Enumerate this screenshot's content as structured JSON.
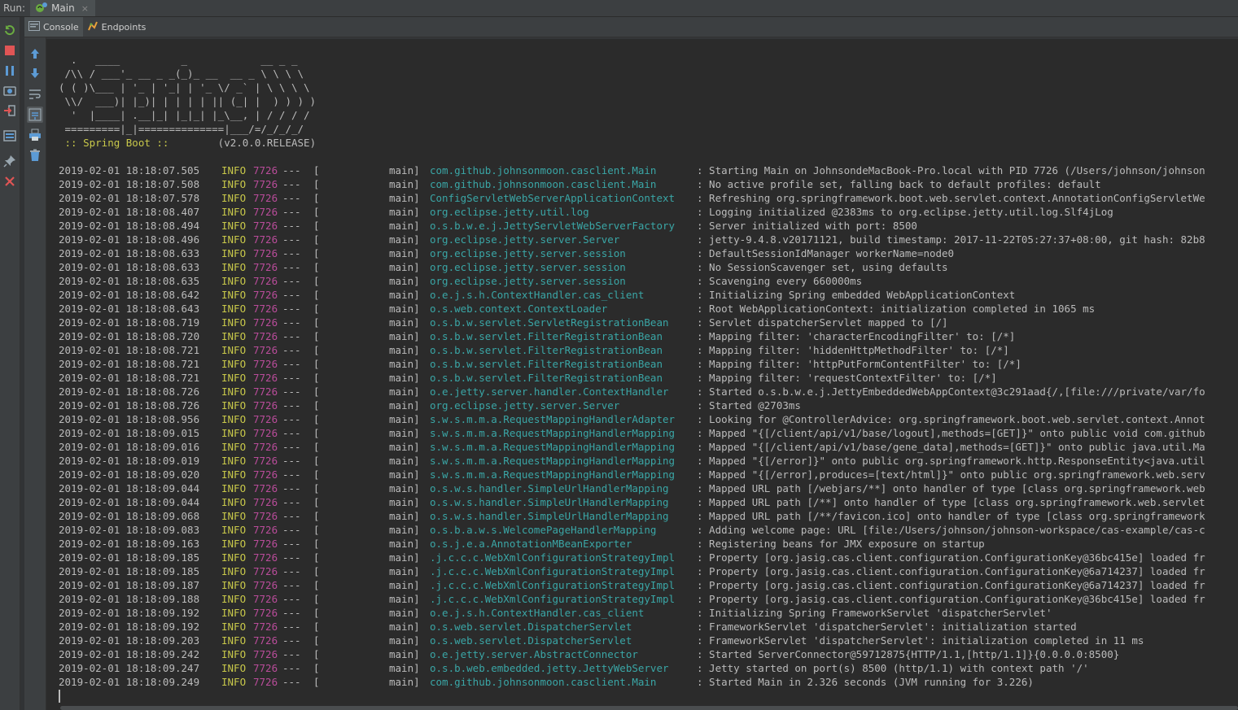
{
  "run_bar": {
    "label": "Run:",
    "tab_title": "Main",
    "close_glyph": "×"
  },
  "sub_tabs": {
    "console": "Console",
    "endpoints": "Endpoints"
  },
  "banner": {
    "lines": [
      "  .   ____          _            __ _ _",
      " /\\\\ / ___'_ __ _ _(_)_ __  __ _ \\ \\ \\ \\",
      "( ( )\\___ | '_ | '_| | '_ \\/ _` | \\ \\ \\ \\",
      " \\\\/  ___)| |_)| | | | | || (_| |  ) ) ) )",
      "  '  |____| .__|_| |_|_| |_\\__, | / / / /",
      " =========|_|==============|___/=/_/_/_/"
    ],
    "spring_label": " :: Spring Boot :: ",
    "version": "       (v2.0.0.RELEASE)"
  },
  "log": [
    {
      "ts": "2019-02-01 18:18:07.505",
      "level": "INFO",
      "pid": "7726",
      "sep": "---",
      "thread": "main]",
      "logger": "com.github.johnsonmoon.casclient.Main",
      "msg": ": Starting Main on JohnsondeMacBook-Pro.local with PID 7726 (/Users/johnson/johnson"
    },
    {
      "ts": "2019-02-01 18:18:07.508",
      "level": "INFO",
      "pid": "7726",
      "sep": "---",
      "thread": "main]",
      "logger": "com.github.johnsonmoon.casclient.Main",
      "msg": ": No active profile set, falling back to default profiles: default"
    },
    {
      "ts": "2019-02-01 18:18:07.578",
      "level": "INFO",
      "pid": "7726",
      "sep": "---",
      "thread": "main]",
      "logger": "ConfigServletWebServerApplicationContext",
      "msg": ": Refreshing org.springframework.boot.web.servlet.context.AnnotationConfigServletWe"
    },
    {
      "ts": "2019-02-01 18:18:08.407",
      "level": "INFO",
      "pid": "7726",
      "sep": "---",
      "thread": "main]",
      "logger": "org.eclipse.jetty.util.log",
      "msg": ": Logging initialized @2383ms to org.eclipse.jetty.util.log.Slf4jLog"
    },
    {
      "ts": "2019-02-01 18:18:08.494",
      "level": "INFO",
      "pid": "7726",
      "sep": "---",
      "thread": "main]",
      "logger": "o.s.b.w.e.j.JettyServletWebServerFactory",
      "msg": ": Server initialized with port: 8500"
    },
    {
      "ts": "2019-02-01 18:18:08.496",
      "level": "INFO",
      "pid": "7726",
      "sep": "---",
      "thread": "main]",
      "logger": "org.eclipse.jetty.server.Server",
      "msg": ": jetty-9.4.8.v20171121, build timestamp: 2017-11-22T05:27:37+08:00, git hash: 82b8"
    },
    {
      "ts": "2019-02-01 18:18:08.633",
      "level": "INFO",
      "pid": "7726",
      "sep": "---",
      "thread": "main]",
      "logger": "org.eclipse.jetty.server.session",
      "msg": ": DefaultSessionIdManager workerName=node0"
    },
    {
      "ts": "2019-02-01 18:18:08.633",
      "level": "INFO",
      "pid": "7726",
      "sep": "---",
      "thread": "main]",
      "logger": "org.eclipse.jetty.server.session",
      "msg": ": No SessionScavenger set, using defaults"
    },
    {
      "ts": "2019-02-01 18:18:08.635",
      "level": "INFO",
      "pid": "7726",
      "sep": "---",
      "thread": "main]",
      "logger": "org.eclipse.jetty.server.session",
      "msg": ": Scavenging every 660000ms"
    },
    {
      "ts": "2019-02-01 18:18:08.642",
      "level": "INFO",
      "pid": "7726",
      "sep": "---",
      "thread": "main]",
      "logger": "o.e.j.s.h.ContextHandler.cas_client",
      "msg": ": Initializing Spring embedded WebApplicationContext"
    },
    {
      "ts": "2019-02-01 18:18:08.643",
      "level": "INFO",
      "pid": "7726",
      "sep": "---",
      "thread": "main]",
      "logger": "o.s.web.context.ContextLoader",
      "msg": ": Root WebApplicationContext: initialization completed in 1065 ms"
    },
    {
      "ts": "2019-02-01 18:18:08.719",
      "level": "INFO",
      "pid": "7726",
      "sep": "---",
      "thread": "main]",
      "logger": "o.s.b.w.servlet.ServletRegistrationBean",
      "msg": ": Servlet dispatcherServlet mapped to [/]"
    },
    {
      "ts": "2019-02-01 18:18:08.720",
      "level": "INFO",
      "pid": "7726",
      "sep": "---",
      "thread": "main]",
      "logger": "o.s.b.w.servlet.FilterRegistrationBean",
      "msg": ": Mapping filter: 'characterEncodingFilter' to: [/*]"
    },
    {
      "ts": "2019-02-01 18:18:08.721",
      "level": "INFO",
      "pid": "7726",
      "sep": "---",
      "thread": "main]",
      "logger": "o.s.b.w.servlet.FilterRegistrationBean",
      "msg": ": Mapping filter: 'hiddenHttpMethodFilter' to: [/*]"
    },
    {
      "ts": "2019-02-01 18:18:08.721",
      "level": "INFO",
      "pid": "7726",
      "sep": "---",
      "thread": "main]",
      "logger": "o.s.b.w.servlet.FilterRegistrationBean",
      "msg": ": Mapping filter: 'httpPutFormContentFilter' to: [/*]"
    },
    {
      "ts": "2019-02-01 18:18:08.721",
      "level": "INFO",
      "pid": "7726",
      "sep": "---",
      "thread": "main]",
      "logger": "o.s.b.w.servlet.FilterRegistrationBean",
      "msg": ": Mapping filter: 'requestContextFilter' to: [/*]"
    },
    {
      "ts": "2019-02-01 18:18:08.726",
      "level": "INFO",
      "pid": "7726",
      "sep": "---",
      "thread": "main]",
      "logger": "o.e.jetty.server.handler.ContextHandler",
      "msg": ": Started o.s.b.w.e.j.JettyEmbeddedWebAppContext@3c291aad{/,[file:///private/var/fo"
    },
    {
      "ts": "2019-02-01 18:18:08.726",
      "level": "INFO",
      "pid": "7726",
      "sep": "---",
      "thread": "main]",
      "logger": "org.eclipse.jetty.server.Server",
      "msg": ": Started @2703ms"
    },
    {
      "ts": "2019-02-01 18:18:08.956",
      "level": "INFO",
      "pid": "7726",
      "sep": "---",
      "thread": "main]",
      "logger": "s.w.s.m.m.a.RequestMappingHandlerAdapter",
      "msg": ": Looking for @ControllerAdvice: org.springframework.boot.web.servlet.context.Annot"
    },
    {
      "ts": "2019-02-01 18:18:09.015",
      "level": "INFO",
      "pid": "7726",
      "sep": "---",
      "thread": "main]",
      "logger": "s.w.s.m.m.a.RequestMappingHandlerMapping",
      "msg": ": Mapped \"{[/client/api/v1/base/logout],methods=[GET]}\" onto public void com.github"
    },
    {
      "ts": "2019-02-01 18:18:09.016",
      "level": "INFO",
      "pid": "7726",
      "sep": "---",
      "thread": "main]",
      "logger": "s.w.s.m.m.a.RequestMappingHandlerMapping",
      "msg": ": Mapped \"{[/client/api/v1/base/gene_data],methods=[GET]}\" onto public java.util.Ma"
    },
    {
      "ts": "2019-02-01 18:18:09.019",
      "level": "INFO",
      "pid": "7726",
      "sep": "---",
      "thread": "main]",
      "logger": "s.w.s.m.m.a.RequestMappingHandlerMapping",
      "msg": ": Mapped \"{[/error]}\" onto public org.springframework.http.ResponseEntity<java.util"
    },
    {
      "ts": "2019-02-01 18:18:09.020",
      "level": "INFO",
      "pid": "7726",
      "sep": "---",
      "thread": "main]",
      "logger": "s.w.s.m.m.a.RequestMappingHandlerMapping",
      "msg": ": Mapped \"{[/error],produces=[text/html]}\" onto public org.springframework.web.serv"
    },
    {
      "ts": "2019-02-01 18:18:09.044",
      "level": "INFO",
      "pid": "7726",
      "sep": "---",
      "thread": "main]",
      "logger": "o.s.w.s.handler.SimpleUrlHandlerMapping",
      "msg": ": Mapped URL path [/webjars/**] onto handler of type [class org.springframework.web"
    },
    {
      "ts": "2019-02-01 18:18:09.044",
      "level": "INFO",
      "pid": "7726",
      "sep": "---",
      "thread": "main]",
      "logger": "o.s.w.s.handler.SimpleUrlHandlerMapping",
      "msg": ": Mapped URL path [/**] onto handler of type [class org.springframework.web.servlet"
    },
    {
      "ts": "2019-02-01 18:18:09.068",
      "level": "INFO",
      "pid": "7726",
      "sep": "---",
      "thread": "main]",
      "logger": "o.s.w.s.handler.SimpleUrlHandlerMapping",
      "msg": ": Mapped URL path [/**/favicon.ico] onto handler of type [class org.springframework"
    },
    {
      "ts": "2019-02-01 18:18:09.083",
      "level": "INFO",
      "pid": "7726",
      "sep": "---",
      "thread": "main]",
      "logger": "o.s.b.a.w.s.WelcomePageHandlerMapping",
      "msg": ": Adding welcome page: URL [file:/Users/johnson/johnson-workspace/cas-example/cas-c"
    },
    {
      "ts": "2019-02-01 18:18:09.163",
      "level": "INFO",
      "pid": "7726",
      "sep": "---",
      "thread": "main]",
      "logger": "o.s.j.e.a.AnnotationMBeanExporter",
      "msg": ": Registering beans for JMX exposure on startup"
    },
    {
      "ts": "2019-02-01 18:18:09.185",
      "level": "INFO",
      "pid": "7726",
      "sep": "---",
      "thread": "main]",
      "logger": ".j.c.c.c.WebXmlConfigurationStrategyImpl",
      "msg": ": Property [org.jasig.cas.client.configuration.ConfigurationKey@36bc415e] loaded fr"
    },
    {
      "ts": "2019-02-01 18:18:09.185",
      "level": "INFO",
      "pid": "7726",
      "sep": "---",
      "thread": "main]",
      "logger": ".j.c.c.c.WebXmlConfigurationStrategyImpl",
      "msg": ": Property [org.jasig.cas.client.configuration.ConfigurationKey@6a714237] loaded fr"
    },
    {
      "ts": "2019-02-01 18:18:09.187",
      "level": "INFO",
      "pid": "7726",
      "sep": "---",
      "thread": "main]",
      "logger": ".j.c.c.c.WebXmlConfigurationStrategyImpl",
      "msg": ": Property [org.jasig.cas.client.configuration.ConfigurationKey@6a714237] loaded fr"
    },
    {
      "ts": "2019-02-01 18:18:09.188",
      "level": "INFO",
      "pid": "7726",
      "sep": "---",
      "thread": "main]",
      "logger": ".j.c.c.c.WebXmlConfigurationStrategyImpl",
      "msg": ": Property [org.jasig.cas.client.configuration.ConfigurationKey@36bc415e] loaded fr"
    },
    {
      "ts": "2019-02-01 18:18:09.192",
      "level": "INFO",
      "pid": "7726",
      "sep": "---",
      "thread": "main]",
      "logger": "o.e.j.s.h.ContextHandler.cas_client",
      "msg": ": Initializing Spring FrameworkServlet 'dispatcherServlet'"
    },
    {
      "ts": "2019-02-01 18:18:09.192",
      "level": "INFO",
      "pid": "7726",
      "sep": "---",
      "thread": "main]",
      "logger": "o.s.web.servlet.DispatcherServlet",
      "msg": ": FrameworkServlet 'dispatcherServlet': initialization started"
    },
    {
      "ts": "2019-02-01 18:18:09.203",
      "level": "INFO",
      "pid": "7726",
      "sep": "---",
      "thread": "main]",
      "logger": "o.s.web.servlet.DispatcherServlet",
      "msg": ": FrameworkServlet 'dispatcherServlet': initialization completed in 11 ms"
    },
    {
      "ts": "2019-02-01 18:18:09.242",
      "level": "INFO",
      "pid": "7726",
      "sep": "---",
      "thread": "main]",
      "logger": "o.e.jetty.server.AbstractConnector",
      "msg": ": Started ServerConnector@59712875{HTTP/1.1,[http/1.1]}{0.0.0.0:8500}"
    },
    {
      "ts": "2019-02-01 18:18:09.247",
      "level": "INFO",
      "pid": "7726",
      "sep": "---",
      "thread": "main]",
      "logger": "o.s.b.web.embedded.jetty.JettyWebServer",
      "msg": ": Jetty started on port(s) 8500 (http/1.1) with context path '/'"
    },
    {
      "ts": "2019-02-01 18:18:09.249",
      "level": "INFO",
      "pid": "7726",
      "sep": "---",
      "thread": "main]",
      "logger": "com.github.johnsonmoon.casclient.Main",
      "msg": ": Started Main in 2.326 seconds (JVM running for 3.226)"
    }
  ]
}
